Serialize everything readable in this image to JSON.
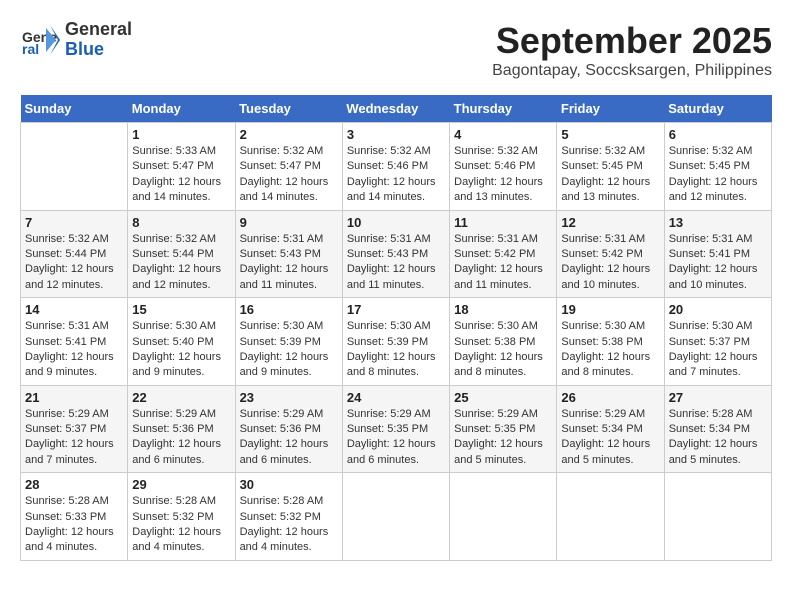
{
  "header": {
    "logo_line1": "General",
    "logo_line2": "Blue",
    "title": "September 2025",
    "subtitle": "Bagontapay, Soccsksargen, Philippines"
  },
  "columns": [
    "Sunday",
    "Monday",
    "Tuesday",
    "Wednesday",
    "Thursday",
    "Friday",
    "Saturday"
  ],
  "weeks": [
    [
      {
        "day": "",
        "info": ""
      },
      {
        "day": "1",
        "info": "Sunrise: 5:33 AM\nSunset: 5:47 PM\nDaylight: 12 hours\nand 14 minutes."
      },
      {
        "day": "2",
        "info": "Sunrise: 5:32 AM\nSunset: 5:47 PM\nDaylight: 12 hours\nand 14 minutes."
      },
      {
        "day": "3",
        "info": "Sunrise: 5:32 AM\nSunset: 5:46 PM\nDaylight: 12 hours\nand 14 minutes."
      },
      {
        "day": "4",
        "info": "Sunrise: 5:32 AM\nSunset: 5:46 PM\nDaylight: 12 hours\nand 13 minutes."
      },
      {
        "day": "5",
        "info": "Sunrise: 5:32 AM\nSunset: 5:45 PM\nDaylight: 12 hours\nand 13 minutes."
      },
      {
        "day": "6",
        "info": "Sunrise: 5:32 AM\nSunset: 5:45 PM\nDaylight: 12 hours\nand 12 minutes."
      }
    ],
    [
      {
        "day": "7",
        "info": "Sunrise: 5:32 AM\nSunset: 5:44 PM\nDaylight: 12 hours\nand 12 minutes."
      },
      {
        "day": "8",
        "info": "Sunrise: 5:32 AM\nSunset: 5:44 PM\nDaylight: 12 hours\nand 12 minutes."
      },
      {
        "day": "9",
        "info": "Sunrise: 5:31 AM\nSunset: 5:43 PM\nDaylight: 12 hours\nand 11 minutes."
      },
      {
        "day": "10",
        "info": "Sunrise: 5:31 AM\nSunset: 5:43 PM\nDaylight: 12 hours\nand 11 minutes."
      },
      {
        "day": "11",
        "info": "Sunrise: 5:31 AM\nSunset: 5:42 PM\nDaylight: 12 hours\nand 11 minutes."
      },
      {
        "day": "12",
        "info": "Sunrise: 5:31 AM\nSunset: 5:42 PM\nDaylight: 12 hours\nand 10 minutes."
      },
      {
        "day": "13",
        "info": "Sunrise: 5:31 AM\nSunset: 5:41 PM\nDaylight: 12 hours\nand 10 minutes."
      }
    ],
    [
      {
        "day": "14",
        "info": "Sunrise: 5:31 AM\nSunset: 5:41 PM\nDaylight: 12 hours\nand 9 minutes."
      },
      {
        "day": "15",
        "info": "Sunrise: 5:30 AM\nSunset: 5:40 PM\nDaylight: 12 hours\nand 9 minutes."
      },
      {
        "day": "16",
        "info": "Sunrise: 5:30 AM\nSunset: 5:39 PM\nDaylight: 12 hours\nand 9 minutes."
      },
      {
        "day": "17",
        "info": "Sunrise: 5:30 AM\nSunset: 5:39 PM\nDaylight: 12 hours\nand 8 minutes."
      },
      {
        "day": "18",
        "info": "Sunrise: 5:30 AM\nSunset: 5:38 PM\nDaylight: 12 hours\nand 8 minutes."
      },
      {
        "day": "19",
        "info": "Sunrise: 5:30 AM\nSunset: 5:38 PM\nDaylight: 12 hours\nand 8 minutes."
      },
      {
        "day": "20",
        "info": "Sunrise: 5:30 AM\nSunset: 5:37 PM\nDaylight: 12 hours\nand 7 minutes."
      }
    ],
    [
      {
        "day": "21",
        "info": "Sunrise: 5:29 AM\nSunset: 5:37 PM\nDaylight: 12 hours\nand 7 minutes."
      },
      {
        "day": "22",
        "info": "Sunrise: 5:29 AM\nSunset: 5:36 PM\nDaylight: 12 hours\nand 6 minutes."
      },
      {
        "day": "23",
        "info": "Sunrise: 5:29 AM\nSunset: 5:36 PM\nDaylight: 12 hours\nand 6 minutes."
      },
      {
        "day": "24",
        "info": "Sunrise: 5:29 AM\nSunset: 5:35 PM\nDaylight: 12 hours\nand 6 minutes."
      },
      {
        "day": "25",
        "info": "Sunrise: 5:29 AM\nSunset: 5:35 PM\nDaylight: 12 hours\nand 5 minutes."
      },
      {
        "day": "26",
        "info": "Sunrise: 5:29 AM\nSunset: 5:34 PM\nDaylight: 12 hours\nand 5 minutes."
      },
      {
        "day": "27",
        "info": "Sunrise: 5:28 AM\nSunset: 5:34 PM\nDaylight: 12 hours\nand 5 minutes."
      }
    ],
    [
      {
        "day": "28",
        "info": "Sunrise: 5:28 AM\nSunset: 5:33 PM\nDaylight: 12 hours\nand 4 minutes."
      },
      {
        "day": "29",
        "info": "Sunrise: 5:28 AM\nSunset: 5:32 PM\nDaylight: 12 hours\nand 4 minutes."
      },
      {
        "day": "30",
        "info": "Sunrise: 5:28 AM\nSunset: 5:32 PM\nDaylight: 12 hours\nand 4 minutes."
      },
      {
        "day": "",
        "info": ""
      },
      {
        "day": "",
        "info": ""
      },
      {
        "day": "",
        "info": ""
      },
      {
        "day": "",
        "info": ""
      }
    ]
  ]
}
